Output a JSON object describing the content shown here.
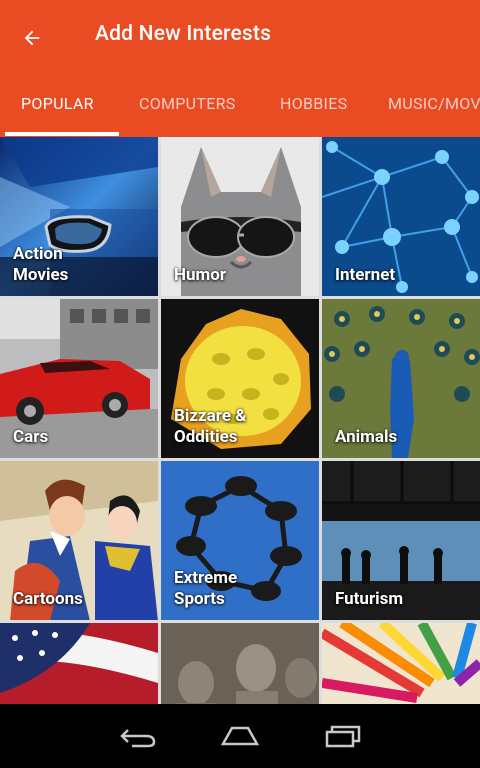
{
  "appbar": {
    "title": "Add New Interests",
    "back_icon": "arrow-back-icon",
    "color": "#e94b23"
  },
  "tabs": [
    {
      "label": "POPULAR",
      "active": true
    },
    {
      "label": "COMPUTERS",
      "active": false
    },
    {
      "label": "HOBBIES",
      "active": false
    },
    {
      "label": "MUSIC/MOVIES",
      "active": false
    }
  ],
  "grid": {
    "tiles": [
      {
        "label": "Action\nMovies"
      },
      {
        "label": "Humor"
      },
      {
        "label": "Internet"
      },
      {
        "label": "Cars"
      },
      {
        "label": "Bizzare &\nOddities"
      },
      {
        "label": "Animals"
      },
      {
        "label": "Cartoons"
      },
      {
        "label": "Extreme\nSports"
      },
      {
        "label": "Futurism"
      },
      {
        "label": ""
      },
      {
        "label": ""
      },
      {
        "label": ""
      }
    ]
  },
  "navbar": {
    "back_icon": "nav-back-icon",
    "home_icon": "nav-home-icon",
    "recents_icon": "nav-recents-icon"
  }
}
